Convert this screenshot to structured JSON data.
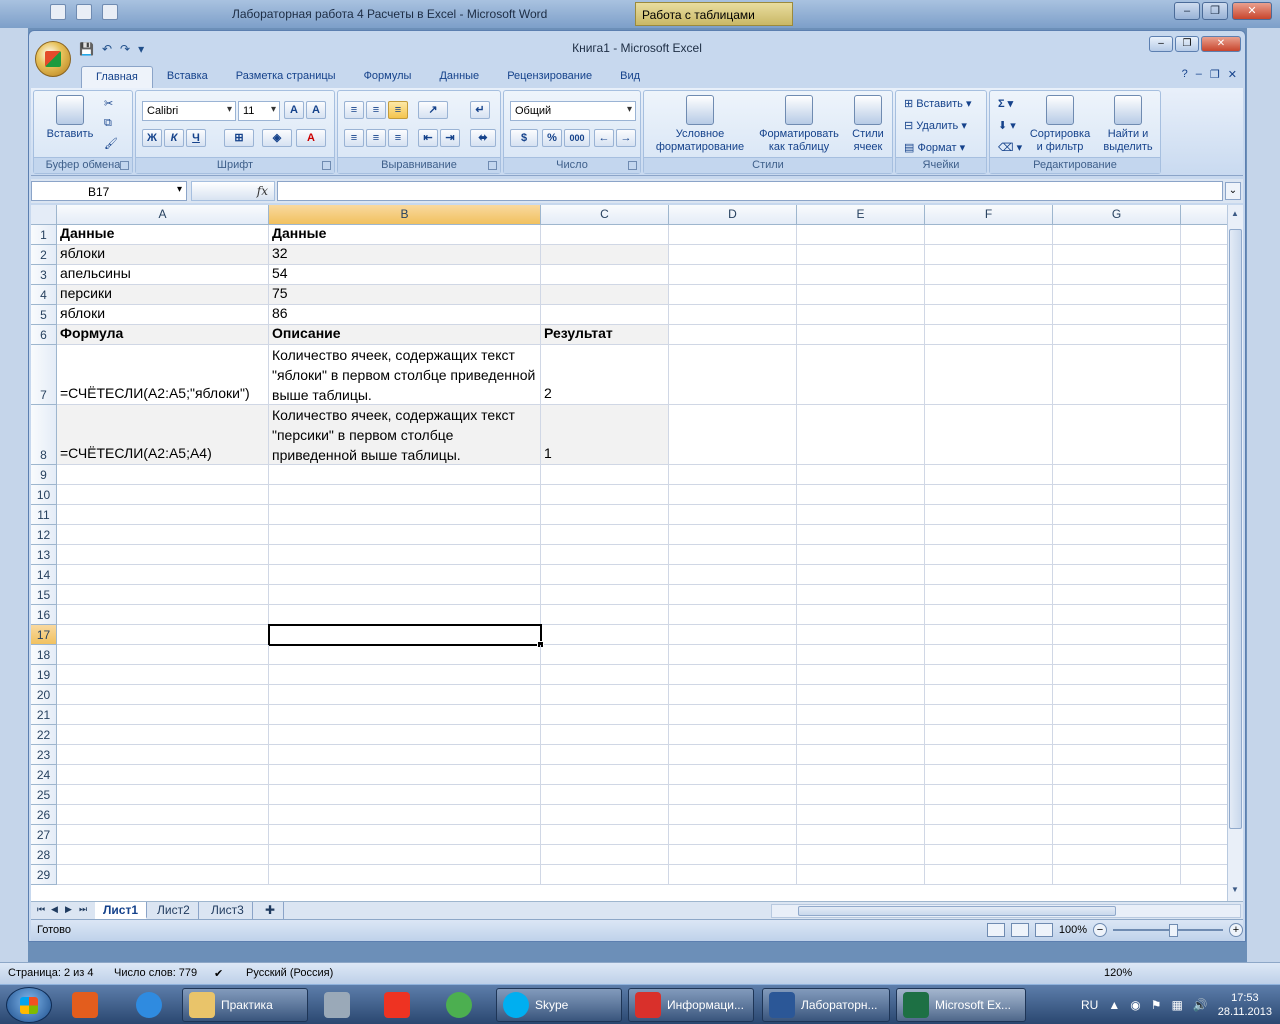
{
  "word": {
    "title": "Лабораторная  работа 4  Расчеты  в  Excel - Microsoft Word",
    "context_tab": "Работа с таблицами",
    "status": {
      "page": "Страница: 2 из 4",
      "words": "Число слов: 779",
      "language": "Русский (Россия)",
      "zoom": "120%"
    }
  },
  "excel": {
    "title": "Книга1 - Microsoft Excel",
    "tabs": [
      "Главная",
      "Вставка",
      "Разметка страницы",
      "Формулы",
      "Данные",
      "Рецензирование",
      "Вид"
    ],
    "ribbon": {
      "clipboard": {
        "label": "Буфер обмена",
        "paste": "Вставить"
      },
      "font": {
        "label": "Шрифт",
        "name": "Calibri",
        "size": "11",
        "bold": "Ж",
        "italic": "К",
        "underline": "Ч"
      },
      "alignment": {
        "label": "Выравнивание"
      },
      "number": {
        "label": "Число",
        "format": "Общий",
        "percent": "%",
        "thousands": "000"
      },
      "styles": {
        "label": "Стили",
        "conditional": [
          "Условное",
          "форматирование"
        ],
        "as_table": [
          "Форматировать",
          "как таблицу"
        ],
        "cell_styles": [
          "Стили",
          "ячеек"
        ]
      },
      "cells": {
        "label": "Ячейки",
        "insert": "Вставить",
        "delete": "Удалить",
        "format": "Формат"
      },
      "editing": {
        "label": "Редактирование",
        "sort": [
          "Сортировка",
          "и фильтр"
        ],
        "find": [
          "Найти и",
          "выделить"
        ],
        "sigma": "Σ"
      }
    },
    "formula_bar": {
      "name_box": "B17",
      "fx": "fx",
      "value": ""
    },
    "columns": [
      "A",
      "B",
      "C",
      "D",
      "E",
      "F",
      "G"
    ],
    "rows": [
      {
        "n": "1",
        "a": "Данные",
        "b": "Данные",
        "c": "",
        "bold": true
      },
      {
        "n": "2",
        "a": "яблоки",
        "b": "32",
        "c": ""
      },
      {
        "n": "3",
        "a": "апельсины",
        "b": "54",
        "c": ""
      },
      {
        "n": "4",
        "a": "персики",
        "b": "75",
        "c": ""
      },
      {
        "n": "5",
        "a": "яблоки",
        "b": "86",
        "c": ""
      },
      {
        "n": "6",
        "a": "Формула",
        "b": "Описание",
        "c": "Результат",
        "bold": true
      },
      {
        "n": "7",
        "a": "=СЧЁТЕСЛИ(A2:A5;\"яблоки\")",
        "b": "Количество ячеек, содержащих текст \"яблоки\" в первом столбце приведенной выше таблицы.",
        "c": "2"
      },
      {
        "n": "8",
        "a": "=СЧЁТЕСЛИ(A2:A5;A4)",
        "b": "Количество ячеек, содержащих текст \"персики\" в первом столбце приведенной выше таблицы.",
        "c": "1"
      }
    ],
    "empty_rows": [
      "9",
      "10",
      "11",
      "12",
      "13",
      "14",
      "15",
      "16",
      "17",
      "18",
      "19",
      "20",
      "21",
      "22",
      "23",
      "24",
      "25",
      "26",
      "27",
      "28",
      "29"
    ],
    "selected_cell": "B17",
    "sheets": [
      "Лист1",
      "Лист2",
      "Лист3"
    ],
    "active_sheet": "Лист1",
    "status": {
      "ready": "Готово",
      "zoom": "100%"
    }
  },
  "taskbar": {
    "items": [
      "Практика",
      "Skype",
      "Информаци...",
      "Лабораторн...",
      "Microsoft Ex..."
    ],
    "lang": "RU",
    "time": "17:53",
    "date": "28.11.2013"
  }
}
